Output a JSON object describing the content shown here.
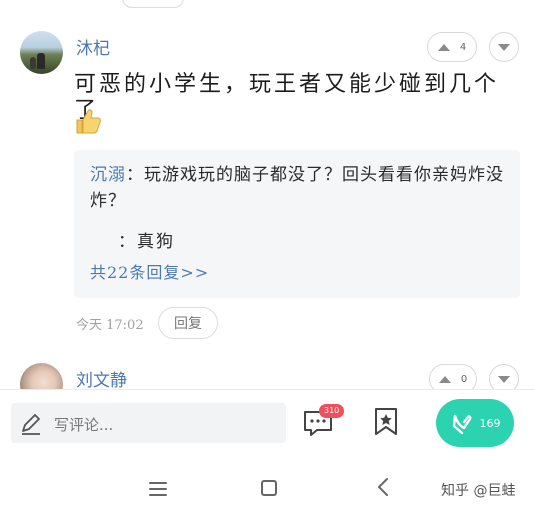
{
  "comment1": {
    "author": "沐杞",
    "text": "可恶的小学生，玩王者又能少碰到几个了",
    "emoji": "thumbs-up",
    "upvotes": "4",
    "replies": {
      "first": {
        "author": "沉溺",
        "text": "：玩游戏玩的脑子都没了？回头看看你亲妈炸没炸？"
      },
      "second": {
        "text": "：真狗"
      },
      "more_label": "共22条回复>>"
    },
    "time": "今天 17:02",
    "reply_label": "回复"
  },
  "comment2": {
    "author": "刘文静",
    "upvotes": "0"
  },
  "bottom_bar": {
    "input_placeholder": "写评论...",
    "comment_badge": "310",
    "like_count": "169"
  },
  "watermark": "知乎 @巨蛙",
  "colors": {
    "username": "#4a79b0",
    "accent": "#2bd3b1",
    "badge": "#f0505b"
  }
}
